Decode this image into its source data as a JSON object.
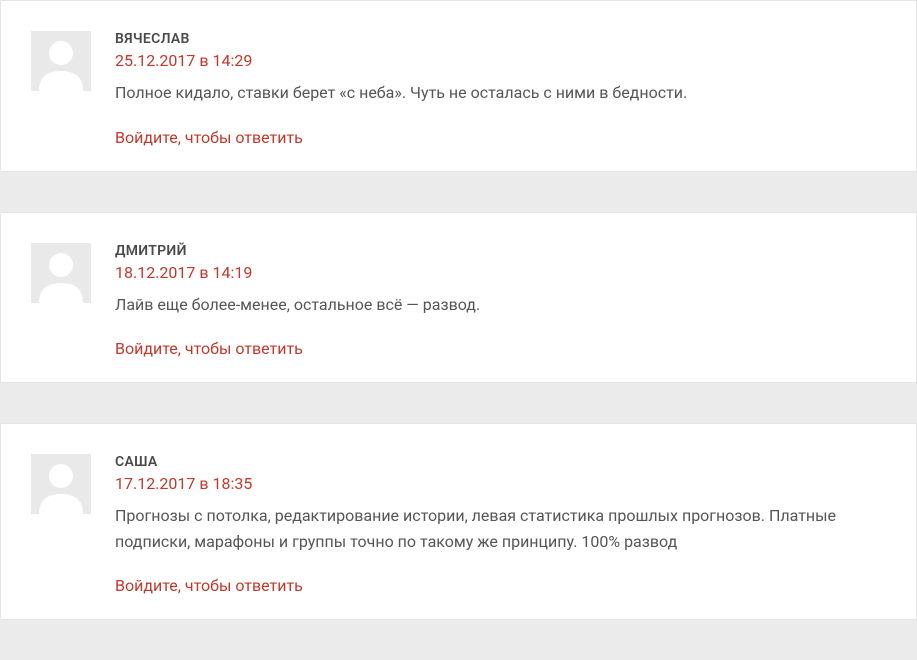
{
  "reply_label": "Войдите, чтобы ответить",
  "comments": [
    {
      "author": "ВЯЧЕСЛАВ",
      "date": "25.12.2017 в 14:29",
      "text": "Полное кидало, ставки берет «с неба». Чуть не осталась с ними в бедности."
    },
    {
      "author": "ДМИТРИЙ",
      "date": "18.12.2017 в 14:19",
      "text": "Лайв еще более-менее, остальное всё — развод."
    },
    {
      "author": "САША",
      "date": "17.12.2017 в 18:35",
      "text": "Прогнозы с потолка, редактирование истории, левая статистика прошлых прогнозов. Платные подписки, марафоны и группы точно по такому же принципу. 100% развод"
    }
  ]
}
